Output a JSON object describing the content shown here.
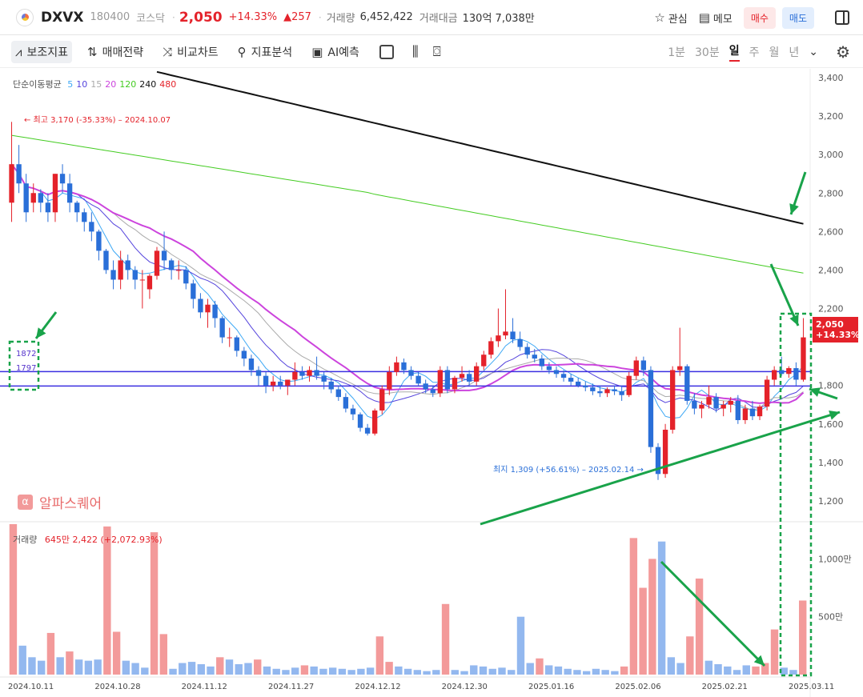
{
  "header": {
    "name": "DXVX",
    "code": "180400",
    "market": "코스닥",
    "separator": "·",
    "price": "2,050",
    "change_pct": "+14.33%",
    "change_val": "▲257",
    "volume_label": "거래량",
    "volume": "6,452,422",
    "amount_label": "거래대금",
    "amount": "130억 7,038만",
    "watch_label": "관심",
    "memo_label": "메모",
    "buy_label": "매수",
    "sell_label": "매도"
  },
  "toolbar": {
    "items": [
      "보조지표",
      "매매전략",
      "비교차트",
      "지표분석",
      "AI예측"
    ],
    "periods": [
      "1분",
      "30분",
      "일",
      "주",
      "월",
      "년"
    ],
    "selected_period": "일"
  },
  "chart_data": {
    "type": "candlestick",
    "title": "",
    "ma_legend_title": "단순이동평균",
    "ma_periods": [
      {
        "label": "5",
        "color": "#3fa9f5"
      },
      {
        "label": "10",
        "color": "#5544dd"
      },
      {
        "label": "15",
        "color": "#aaaaaa"
      },
      {
        "label": "20",
        "color": "#cc44dd"
      },
      {
        "label": "120",
        "color": "#44cc22"
      },
      {
        "label": "240",
        "color": "#111111"
      },
      {
        "label": "480",
        "color": "#e4222a"
      }
    ],
    "price_axis": {
      "ticks": [
        "3,400",
        "3,200",
        "3,000",
        "2,800",
        "2,600",
        "2,400",
        "2,200",
        "1,800",
        "1,600",
        "1,400",
        "1,200"
      ],
      "values": [
        3400,
        3200,
        3000,
        2800,
        2600,
        2400,
        2200,
        1800,
        1600,
        1400,
        1200
      ],
      "range": [
        1100,
        3400
      ]
    },
    "volume_axis": {
      "ticks": [
        "1,000만",
        "500만"
      ],
      "values": [
        10000000,
        5000000
      ],
      "max": 13000000
    },
    "x_labels": [
      "2024.10.11",
      "2024.10.28",
      "2024.11.12",
      "2024.11.27",
      "2024.12.12",
      "2024.12.30",
      "2025.01.16",
      "2025.02.06",
      "2025.02.21",
      "2025.03.11"
    ],
    "high_note": "최고 3,170 (-35.33%) – 2024.10.07",
    "low_note": "최지 1,309 (+56.61%) – 2025.02.14",
    "current_price": "2,050",
    "current_pct": "+14.33%",
    "horizontal_lines": [
      {
        "label": "1872",
        "value": 1872
      },
      {
        "label": "1797",
        "value": 1797
      }
    ],
    "volume_legend_label": "거래량",
    "volume_legend_value": "645만 2,422 (+2,072.93%)",
    "candles": [
      [
        2750,
        3170,
        2650,
        2950
      ],
      [
        2950,
        3050,
        2800,
        2850
      ],
      [
        2850,
        2900,
        2650,
        2700
      ],
      [
        2750,
        2850,
        2700,
        2800
      ],
      [
        2800,
        2820,
        2700,
        2750
      ],
      [
        2750,
        2800,
        2650,
        2700
      ],
      [
        2700,
        2900,
        2650,
        2900
      ],
      [
        2900,
        2950,
        2800,
        2850
      ],
      [
        2850,
        2900,
        2700,
        2750
      ],
      [
        2750,
        2760,
        2650,
        2700
      ],
      [
        2700,
        2720,
        2600,
        2650
      ],
      [
        2650,
        2700,
        2550,
        2600
      ],
      [
        2600,
        2610,
        2450,
        2500
      ],
      [
        2500,
        2510,
        2380,
        2400
      ],
      [
        2400,
        2450,
        2300,
        2350
      ],
      [
        2350,
        2500,
        2300,
        2450
      ],
      [
        2450,
        2480,
        2350,
        2400
      ],
      [
        2400,
        2420,
        2300,
        2350
      ],
      [
        2350,
        2400,
        2200,
        2350
      ],
      [
        2300,
        2380,
        2250,
        2370
      ],
      [
        2370,
        2520,
        2350,
        2500
      ],
      [
        2500,
        2600,
        2400,
        2450
      ],
      [
        2450,
        2460,
        2350,
        2400
      ],
      [
        2400,
        2450,
        2350,
        2400
      ],
      [
        2400,
        2420,
        2300,
        2330
      ],
      [
        2330,
        2350,
        2200,
        2250
      ],
      [
        2250,
        2280,
        2150,
        2180
      ],
      [
        2180,
        2250,
        2100,
        2220
      ],
      [
        2220,
        2240,
        2100,
        2150
      ],
      [
        2150,
        2160,
        2020,
        2050
      ],
      [
        2050,
        2100,
        2000,
        2050
      ],
      [
        2050,
        2060,
        1950,
        1980
      ],
      [
        1980,
        2000,
        1900,
        1940
      ],
      [
        1940,
        1960,
        1850,
        1880
      ],
      [
        1880,
        1900,
        1800,
        1850
      ],
      [
        1850,
        1870,
        1760,
        1800
      ],
      [
        1800,
        1850,
        1770,
        1820
      ],
      [
        1820,
        1850,
        1780,
        1800
      ],
      [
        1800,
        1830,
        1750,
        1830
      ],
      [
        1830,
        1920,
        1800,
        1870
      ],
      [
        1870,
        1900,
        1830,
        1850
      ],
      [
        1850,
        1900,
        1820,
        1880
      ],
      [
        1880,
        1950,
        1830,
        1850
      ],
      [
        1850,
        1870,
        1780,
        1820
      ],
      [
        1820,
        1840,
        1760,
        1780
      ],
      [
        1780,
        1800,
        1720,
        1740
      ],
      [
        1740,
        1760,
        1660,
        1680
      ],
      [
        1680,
        1700,
        1620,
        1650
      ],
      [
        1650,
        1660,
        1560,
        1580
      ],
      [
        1580,
        1600,
        1540,
        1550
      ],
      [
        1550,
        1680,
        1540,
        1670
      ],
      [
        1670,
        1800,
        1650,
        1780
      ],
      [
        1780,
        1900,
        1750,
        1870
      ],
      [
        1870,
        1950,
        1850,
        1920
      ],
      [
        1920,
        1940,
        1860,
        1880
      ],
      [
        1880,
        1900,
        1830,
        1850
      ],
      [
        1850,
        1870,
        1800,
        1810
      ],
      [
        1810,
        1830,
        1760,
        1780
      ],
      [
        1780,
        1800,
        1740,
        1760
      ],
      [
        1760,
        1900,
        1740,
        1880
      ],
      [
        1880,
        1900,
        1760,
        1780
      ],
      [
        1780,
        1850,
        1760,
        1840
      ],
      [
        1840,
        1900,
        1820,
        1860
      ],
      [
        1860,
        1880,
        1800,
        1820
      ],
      [
        1820,
        1920,
        1800,
        1900
      ],
      [
        1900,
        1980,
        1880,
        1960
      ],
      [
        1960,
        2050,
        1940,
        2030
      ],
      [
        2030,
        2200,
        2000,
        2060
      ],
      [
        2060,
        2300,
        2040,
        2080
      ],
      [
        2080,
        2150,
        2020,
        2040
      ],
      [
        2040,
        2080,
        1980,
        2000
      ],
      [
        2000,
        2020,
        1940,
        1960
      ],
      [
        1960,
        1990,
        1920,
        1940
      ],
      [
        1940,
        1960,
        1880,
        1900
      ],
      [
        1900,
        1920,
        1860,
        1880
      ],
      [
        1880,
        1900,
        1840,
        1860
      ],
      [
        1860,
        1880,
        1820,
        1840
      ],
      [
        1840,
        1860,
        1800,
        1820
      ],
      [
        1820,
        1840,
        1790,
        1800
      ],
      [
        1800,
        1820,
        1770,
        1790
      ],
      [
        1790,
        1810,
        1750,
        1770
      ],
      [
        1770,
        1800,
        1740,
        1760
      ],
      [
        1760,
        1790,
        1740,
        1780
      ],
      [
        1780,
        1800,
        1750,
        1770
      ],
      [
        1770,
        1800,
        1720,
        1750
      ],
      [
        1750,
        1870,
        1740,
        1850
      ],
      [
        1850,
        1950,
        1830,
        1930
      ],
      [
        1930,
        1950,
        1850,
        1880
      ],
      [
        1880,
        1900,
        1450,
        1480
      ],
      [
        1480,
        1500,
        1309,
        1340
      ],
      [
        1340,
        1600,
        1320,
        1570
      ],
      [
        1570,
        1900,
        1550,
        1880
      ],
      [
        1880,
        2100,
        1850,
        1900
      ],
      [
        1900,
        1910,
        1700,
        1720
      ],
      [
        1720,
        1760,
        1650,
        1680
      ],
      [
        1680,
        1720,
        1630,
        1700
      ],
      [
        1700,
        1800,
        1680,
        1740
      ],
      [
        1740,
        1760,
        1660,
        1680
      ],
      [
        1680,
        1720,
        1640,
        1700
      ],
      [
        1700,
        1740,
        1660,
        1720
      ],
      [
        1720,
        1750,
        1600,
        1620
      ],
      [
        1620,
        1700,
        1600,
        1680
      ],
      [
        1680,
        1720,
        1620,
        1640
      ],
      [
        1640,
        1700,
        1620,
        1690
      ],
      [
        1690,
        1850,
        1670,
        1830
      ],
      [
        1830,
        1900,
        1800,
        1880
      ],
      [
        1880,
        1950,
        1850,
        1860
      ],
      [
        1860,
        1900,
        1840,
        1890
      ],
      [
        1890,
        1920,
        1800,
        1830
      ],
      [
        1830,
        2150,
        1820,
        2050
      ]
    ],
    "volumes": [
      [
        13000000,
        "up"
      ],
      [
        2500000,
        "down"
      ],
      [
        1500000,
        "down"
      ],
      [
        1200000,
        "down"
      ],
      [
        3600000,
        "up"
      ],
      [
        1500000,
        "down"
      ],
      [
        2000000,
        "up"
      ],
      [
        1300000,
        "down"
      ],
      [
        1200000,
        "down"
      ],
      [
        1300000,
        "down"
      ],
      [
        12800000,
        "up"
      ],
      [
        3700000,
        "up"
      ],
      [
        1200000,
        "down"
      ],
      [
        1000000,
        "down"
      ],
      [
        600000,
        "down"
      ],
      [
        12300000,
        "up"
      ],
      [
        3500000,
        "up"
      ],
      [
        500000,
        "down"
      ],
      [
        1000000,
        "down"
      ],
      [
        1100000,
        "down"
      ],
      [
        900000,
        "down"
      ],
      [
        700000,
        "down"
      ],
      [
        1500000,
        "up"
      ],
      [
        1300000,
        "down"
      ],
      [
        900000,
        "down"
      ],
      [
        1000000,
        "down"
      ],
      [
        1300000,
        "up"
      ],
      [
        700000,
        "down"
      ],
      [
        500000,
        "down"
      ],
      [
        400000,
        "down"
      ],
      [
        600000,
        "down"
      ],
      [
        800000,
        "up"
      ],
      [
        700000,
        "down"
      ],
      [
        500000,
        "down"
      ],
      [
        600000,
        "down"
      ],
      [
        500000,
        "down"
      ],
      [
        400000,
        "down"
      ],
      [
        500000,
        "down"
      ],
      [
        600000,
        "down"
      ],
      [
        3300000,
        "up"
      ],
      [
        1100000,
        "up"
      ],
      [
        700000,
        "down"
      ],
      [
        500000,
        "down"
      ],
      [
        400000,
        "down"
      ],
      [
        300000,
        "down"
      ],
      [
        400000,
        "down"
      ],
      [
        6100000,
        "up"
      ],
      [
        400000,
        "down"
      ],
      [
        300000,
        "down"
      ],
      [
        800000,
        "down"
      ],
      [
        700000,
        "down"
      ],
      [
        500000,
        "down"
      ],
      [
        600000,
        "down"
      ],
      [
        400000,
        "down"
      ],
      [
        5000000,
        "down"
      ],
      [
        1000000,
        "down"
      ],
      [
        1400000,
        "up"
      ],
      [
        800000,
        "down"
      ],
      [
        700000,
        "down"
      ],
      [
        500000,
        "down"
      ],
      [
        400000,
        "down"
      ],
      [
        300000,
        "down"
      ],
      [
        500000,
        "down"
      ],
      [
        400000,
        "down"
      ],
      [
        300000,
        "down"
      ],
      [
        700000,
        "up"
      ],
      [
        11800000,
        "up"
      ],
      [
        7500000,
        "up"
      ],
      [
        10000000,
        "up"
      ],
      [
        11500000,
        "down"
      ],
      [
        1500000,
        "down"
      ],
      [
        1000000,
        "down"
      ],
      [
        3300000,
        "up"
      ],
      [
        8300000,
        "up"
      ],
      [
        1200000,
        "down"
      ],
      [
        900000,
        "down"
      ],
      [
        700000,
        "down"
      ],
      [
        400000,
        "down"
      ],
      [
        800000,
        "down"
      ],
      [
        700000,
        "up"
      ],
      [
        1000000,
        "up"
      ],
      [
        3900000,
        "up"
      ],
      [
        600000,
        "down"
      ],
      [
        400000,
        "down"
      ],
      [
        6400000,
        "up"
      ]
    ]
  }
}
